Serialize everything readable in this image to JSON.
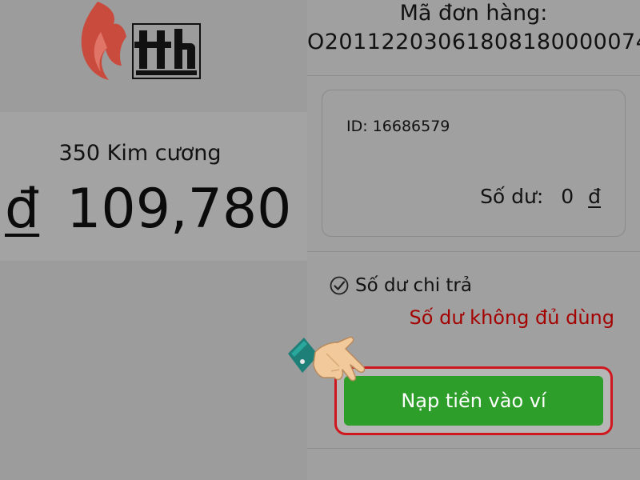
{
  "header": {
    "logo_text": "tth"
  },
  "product": {
    "name": "350 Kim cương",
    "currency_symbol": "đ",
    "price": "109,780"
  },
  "order": {
    "label": "Mã đơn hàng:",
    "code": "O20112203061808180000074"
  },
  "wallet": {
    "id_text": "ID:  16686579",
    "balance_label": "Số dư:",
    "balance_value": "0",
    "balance_currency": "đ"
  },
  "payment": {
    "option_label": "Số dư chi trả",
    "checked": true,
    "warning": "Số dư không đủ dùng"
  },
  "actions": {
    "topup_label": "Nạp tiền vào ví"
  },
  "colors": {
    "accent_button": "#2e9e2b",
    "highlight_border": "#d0171f",
    "warning_text": "#a40000",
    "logo_flame": "#c94b3e"
  },
  "icons": {
    "logo": "tth-flame-logo",
    "check": "check-icon",
    "pointer": "pointing-hand-icon"
  }
}
